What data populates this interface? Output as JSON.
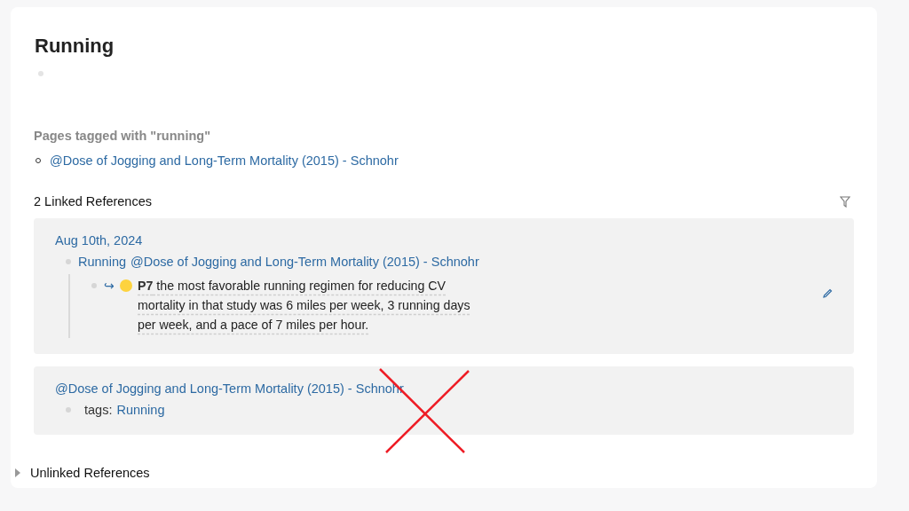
{
  "page": {
    "title": "Running",
    "empty_bullet": true
  },
  "tagged": {
    "heading": "Pages tagged with \"running\"",
    "pages": [
      "@Dose of Jogging and Long-Term Mortality (2015) - Schnohr"
    ]
  },
  "linked": {
    "heading": "2 Linked References",
    "groups": [
      {
        "title": "Aug 10th, 2024",
        "items": [
          {
            "links": [
              "Running",
              "@Dose of Jogging and Long-Term Mortality (2015) - Schnohr"
            ],
            "children": [
              {
                "ref_arrow": "↪",
                "text": "**P7**  the most favorable running regimen for reducing CV mortality in that study was 6 miles per week, 3 running days per week, and a pace of 7 miles per hour."
              }
            ]
          }
        ]
      },
      {
        "title": "@Dose of Jogging and Long-Term Mortality (2015) - Schnohr",
        "items": [
          {
            "label": "tags:",
            "links": [
              "Running"
            ]
          }
        ]
      }
    ]
  },
  "unlinked": {
    "heading": "Unlinked References",
    "expanded": false
  },
  "annotation": {
    "kind": "cross"
  }
}
